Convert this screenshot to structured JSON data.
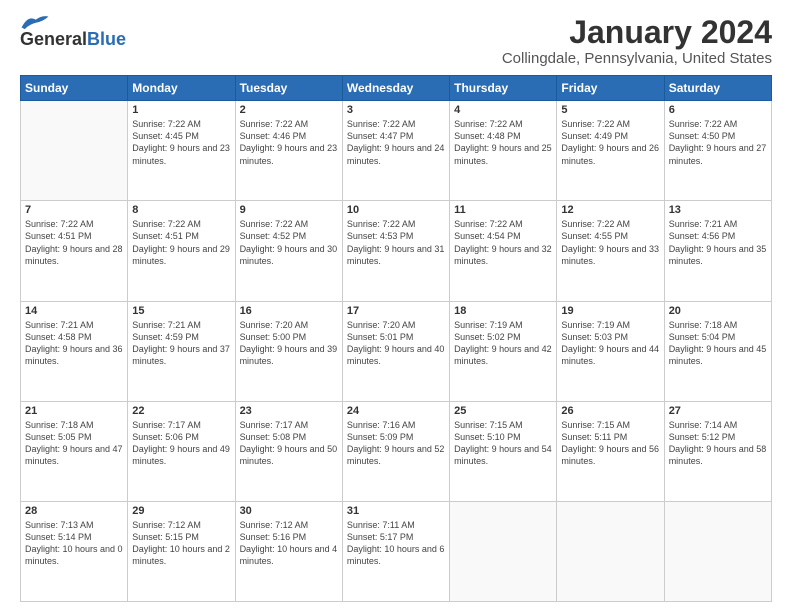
{
  "header": {
    "logo_text_general": "General",
    "logo_text_blue": "Blue",
    "title": "January 2024",
    "subtitle": "Collingdale, Pennsylvania, United States"
  },
  "days_of_week": [
    "Sunday",
    "Monday",
    "Tuesday",
    "Wednesday",
    "Thursday",
    "Friday",
    "Saturday"
  ],
  "weeks": [
    [
      {
        "day": "",
        "info": ""
      },
      {
        "day": "1",
        "info": "Sunrise: 7:22 AM\nSunset: 4:45 PM\nDaylight: 9 hours\nand 23 minutes."
      },
      {
        "day": "2",
        "info": "Sunrise: 7:22 AM\nSunset: 4:46 PM\nDaylight: 9 hours\nand 23 minutes."
      },
      {
        "day": "3",
        "info": "Sunrise: 7:22 AM\nSunset: 4:47 PM\nDaylight: 9 hours\nand 24 minutes."
      },
      {
        "day": "4",
        "info": "Sunrise: 7:22 AM\nSunset: 4:48 PM\nDaylight: 9 hours\nand 25 minutes."
      },
      {
        "day": "5",
        "info": "Sunrise: 7:22 AM\nSunset: 4:49 PM\nDaylight: 9 hours\nand 26 minutes."
      },
      {
        "day": "6",
        "info": "Sunrise: 7:22 AM\nSunset: 4:50 PM\nDaylight: 9 hours\nand 27 minutes."
      }
    ],
    [
      {
        "day": "7",
        "info": "Sunrise: 7:22 AM\nSunset: 4:51 PM\nDaylight: 9 hours\nand 28 minutes."
      },
      {
        "day": "8",
        "info": "Sunrise: 7:22 AM\nSunset: 4:51 PM\nDaylight: 9 hours\nand 29 minutes."
      },
      {
        "day": "9",
        "info": "Sunrise: 7:22 AM\nSunset: 4:52 PM\nDaylight: 9 hours\nand 30 minutes."
      },
      {
        "day": "10",
        "info": "Sunrise: 7:22 AM\nSunset: 4:53 PM\nDaylight: 9 hours\nand 31 minutes."
      },
      {
        "day": "11",
        "info": "Sunrise: 7:22 AM\nSunset: 4:54 PM\nDaylight: 9 hours\nand 32 minutes."
      },
      {
        "day": "12",
        "info": "Sunrise: 7:22 AM\nSunset: 4:55 PM\nDaylight: 9 hours\nand 33 minutes."
      },
      {
        "day": "13",
        "info": "Sunrise: 7:21 AM\nSunset: 4:56 PM\nDaylight: 9 hours\nand 35 minutes."
      }
    ],
    [
      {
        "day": "14",
        "info": "Sunrise: 7:21 AM\nSunset: 4:58 PM\nDaylight: 9 hours\nand 36 minutes."
      },
      {
        "day": "15",
        "info": "Sunrise: 7:21 AM\nSunset: 4:59 PM\nDaylight: 9 hours\nand 37 minutes."
      },
      {
        "day": "16",
        "info": "Sunrise: 7:20 AM\nSunset: 5:00 PM\nDaylight: 9 hours\nand 39 minutes."
      },
      {
        "day": "17",
        "info": "Sunrise: 7:20 AM\nSunset: 5:01 PM\nDaylight: 9 hours\nand 40 minutes."
      },
      {
        "day": "18",
        "info": "Sunrise: 7:19 AM\nSunset: 5:02 PM\nDaylight: 9 hours\nand 42 minutes."
      },
      {
        "day": "19",
        "info": "Sunrise: 7:19 AM\nSunset: 5:03 PM\nDaylight: 9 hours\nand 44 minutes."
      },
      {
        "day": "20",
        "info": "Sunrise: 7:18 AM\nSunset: 5:04 PM\nDaylight: 9 hours\nand 45 minutes."
      }
    ],
    [
      {
        "day": "21",
        "info": "Sunrise: 7:18 AM\nSunset: 5:05 PM\nDaylight: 9 hours\nand 47 minutes."
      },
      {
        "day": "22",
        "info": "Sunrise: 7:17 AM\nSunset: 5:06 PM\nDaylight: 9 hours\nand 49 minutes."
      },
      {
        "day": "23",
        "info": "Sunrise: 7:17 AM\nSunset: 5:08 PM\nDaylight: 9 hours\nand 50 minutes."
      },
      {
        "day": "24",
        "info": "Sunrise: 7:16 AM\nSunset: 5:09 PM\nDaylight: 9 hours\nand 52 minutes."
      },
      {
        "day": "25",
        "info": "Sunrise: 7:15 AM\nSunset: 5:10 PM\nDaylight: 9 hours\nand 54 minutes."
      },
      {
        "day": "26",
        "info": "Sunrise: 7:15 AM\nSunset: 5:11 PM\nDaylight: 9 hours\nand 56 minutes."
      },
      {
        "day": "27",
        "info": "Sunrise: 7:14 AM\nSunset: 5:12 PM\nDaylight: 9 hours\nand 58 minutes."
      }
    ],
    [
      {
        "day": "28",
        "info": "Sunrise: 7:13 AM\nSunset: 5:14 PM\nDaylight: 10 hours\nand 0 minutes."
      },
      {
        "day": "29",
        "info": "Sunrise: 7:12 AM\nSunset: 5:15 PM\nDaylight: 10 hours\nand 2 minutes."
      },
      {
        "day": "30",
        "info": "Sunrise: 7:12 AM\nSunset: 5:16 PM\nDaylight: 10 hours\nand 4 minutes."
      },
      {
        "day": "31",
        "info": "Sunrise: 7:11 AM\nSunset: 5:17 PM\nDaylight: 10 hours\nand 6 minutes."
      },
      {
        "day": "",
        "info": ""
      },
      {
        "day": "",
        "info": ""
      },
      {
        "day": "",
        "info": ""
      }
    ]
  ]
}
